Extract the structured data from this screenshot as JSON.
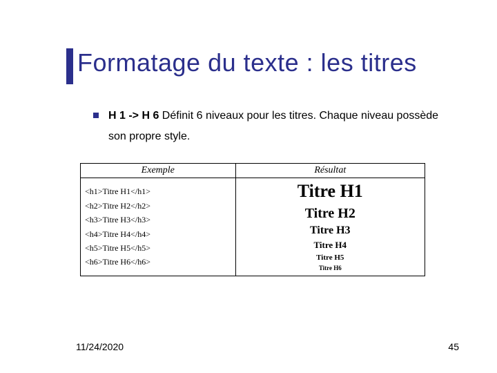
{
  "title": "Formatage du texte : les titres",
  "bullet": {
    "tag_range": "H 1 -> H 6",
    "rest": " Définit 6 niveaux pour les titres. Chaque niveau possède son propre style."
  },
  "table": {
    "headers": {
      "example": "Exemple",
      "result": "Résultat"
    },
    "code_lines": [
      "<h1>Titre H1</h1>",
      "<h2>Titre H2</h2>",
      "<h3>Titre H3</h3>",
      "<h4>Titre H4</h4>",
      "<h5>Titre H5</h5>",
      "<h6>Titre H6</h6>"
    ],
    "results": [
      "Titre H1",
      "Titre H2",
      "Titre H3",
      "Titre H4",
      "Titre H5",
      "Titre H6"
    ]
  },
  "footer": {
    "date": "11/24/2020",
    "page": "45"
  }
}
